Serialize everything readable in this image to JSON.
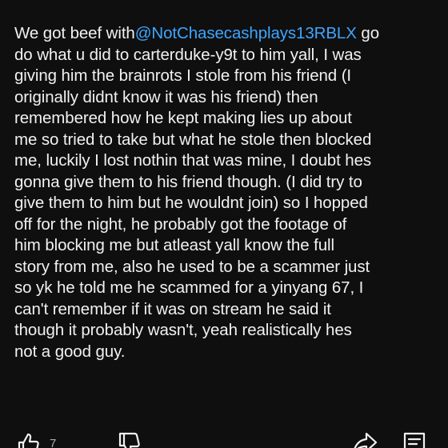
{
  "comment": {
    "line_1_prefix": "We got beef with",
    "mention": "@NotChasecashplays13RBLX",
    "line_1_suffix": " go",
    "lines": [
      "do what u did to carterduke-y9t to him yall, I was",
      "giving him the brainrots I stole from his friend (I",
      "originally didnt know it was his friend) then",
      "remembered how he kept making lies up about",
      "me so tried to take but what he stole then blocked",
      "me, luckily I lost nothin that was mine, I doubt hes",
      "gonna give them to his friend though. (I did try to",
      "give them to him but he wouldnt join) so I hopped",
      "off for the night, he probably got the footage of",
      "him blocking me but atleast yall know the full",
      "story from me, also he used to be a scammer just",
      "so yk he told me he scammed for a yinyang 67, I",
      "can't remember if it was on stream he said it",
      "though it probably wasn't, yeah realistically hes",
      "not a good guy."
    ]
  },
  "actions": {
    "like_count": "7",
    "icons": [
      "thumbs-up-icon",
      "thumbs-down-icon",
      "share-icon",
      "reply-icon"
    ]
  },
  "colors": {
    "background": "#0f0f0f",
    "text": "#f1f1f1",
    "mention": "#3ea6ff",
    "secondary_text": "#aaaaaa"
  }
}
